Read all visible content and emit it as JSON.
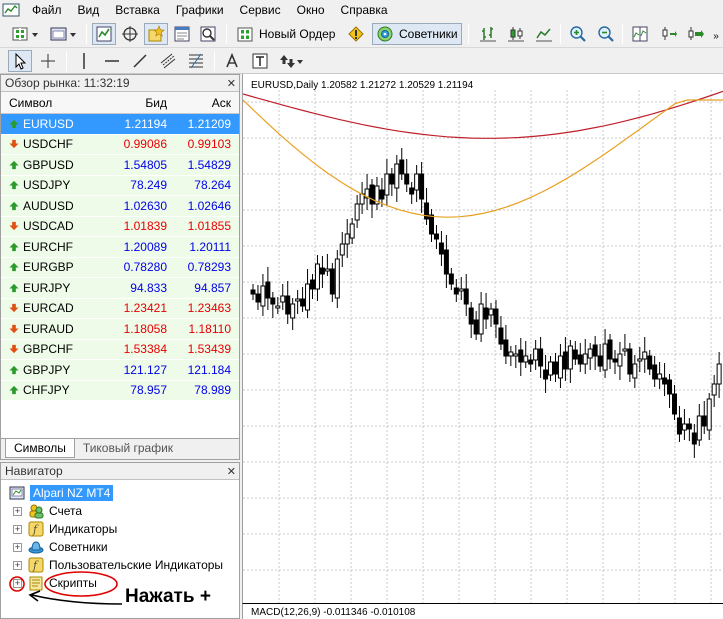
{
  "menu": [
    "Файл",
    "Вид",
    "Вставка",
    "Графики",
    "Сервис",
    "Окно",
    "Справка"
  ],
  "toolbar": {
    "new_order": "Новый Ордер",
    "experts": "Советники"
  },
  "market_watch": {
    "title": "Обзор рынка: 11:32:19",
    "headers": {
      "symbol": "Символ",
      "bid": "Бид",
      "ask": "Аск"
    },
    "rows": [
      {
        "symbol": "EURUSD",
        "bid": "1.21194",
        "ask": "1.21209",
        "dir": "up",
        "selected": true
      },
      {
        "symbol": "USDCHF",
        "bid": "0.99086",
        "ask": "0.99103",
        "dir": "down"
      },
      {
        "symbol": "GBPUSD",
        "bid": "1.54805",
        "ask": "1.54829",
        "dir": "up"
      },
      {
        "symbol": "USDJPY",
        "bid": "78.249",
        "ask": "78.264",
        "dir": "up"
      },
      {
        "symbol": "AUDUSD",
        "bid": "1.02630",
        "ask": "1.02646",
        "dir": "up"
      },
      {
        "symbol": "USDCAD",
        "bid": "1.01839",
        "ask": "1.01855",
        "dir": "down"
      },
      {
        "symbol": "EURCHF",
        "bid": "1.20089",
        "ask": "1.20111",
        "dir": "up"
      },
      {
        "symbol": "EURGBP",
        "bid": "0.78280",
        "ask": "0.78293",
        "dir": "up"
      },
      {
        "symbol": "EURJPY",
        "bid": "94.833",
        "ask": "94.857",
        "dir": "up"
      },
      {
        "symbol": "EURCAD",
        "bid": "1.23421",
        "ask": "1.23463",
        "dir": "down"
      },
      {
        "symbol": "EURAUD",
        "bid": "1.18058",
        "ask": "1.18110",
        "dir": "down"
      },
      {
        "symbol": "GBPCHF",
        "bid": "1.53384",
        "ask": "1.53439",
        "dir": "down"
      },
      {
        "symbol": "GBPJPY",
        "bid": "121.127",
        "ask": "121.184",
        "dir": "up"
      },
      {
        "symbol": "CHFJPY",
        "bid": "78.957",
        "ask": "78.989",
        "dir": "up"
      }
    ],
    "tabs": [
      "Символы",
      "Тиковый график"
    ]
  },
  "navigator": {
    "title": "Навигатор",
    "root": "Alpari NZ MT4",
    "items": [
      "Счета",
      "Индикаторы",
      "Советники",
      "Пользовательские Индикаторы",
      "Скрипты"
    ]
  },
  "chart": {
    "title": "EURUSD,Daily  1.20582 1.21272 1.20529 1.21194",
    "macd_label": "MACD(12,26,9) -0.011346 -0.010108"
  },
  "annotation": "Нажать +",
  "colors": {
    "up": "#0000e8",
    "down": "#e80000",
    "selection": "#3399ff",
    "ma_slow": "#c0202a",
    "ma_fast": "#e8a020",
    "annotation": "#e00000"
  }
}
